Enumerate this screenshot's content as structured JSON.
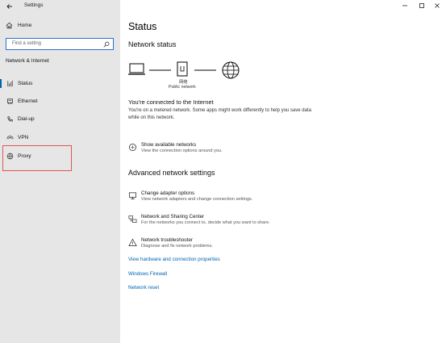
{
  "window": {
    "title": "Settings"
  },
  "sidebar": {
    "home_label": "Home",
    "search_placeholder": "Find a setting",
    "section_heading": "Network & Internet",
    "items": [
      {
        "label": "Status",
        "icon": "home-network-icon",
        "selected": true
      },
      {
        "label": "Ethernet",
        "icon": "ethernet-icon",
        "selected": false
      },
      {
        "label": "Dial-up",
        "icon": "dial-up-icon",
        "selected": false
      },
      {
        "label": "VPN",
        "icon": "vpn-icon",
        "selected": false
      },
      {
        "label": "Proxy",
        "icon": "globe-icon",
        "selected": false
      }
    ]
  },
  "main": {
    "page_title": "Status",
    "network_status_heading": "Network status",
    "diagram": {
      "network_name": "网络",
      "network_type": "Public network"
    },
    "connected_text": "You're connected to the Internet",
    "metered_desc": "You're on a metered network. Some apps might work differently to help you save data while on this network.",
    "show_networks": {
      "title": "Show available networks",
      "subtitle": "View the connection options around you."
    },
    "advanced_heading": "Advanced network settings",
    "actions": [
      {
        "title": "Change adapter options",
        "subtitle": "View network adapters and change connection settings.",
        "icon": "adapter-icon"
      },
      {
        "title": "Network and Sharing Center",
        "subtitle": "For the networks you connect to, decide what you want to share.",
        "icon": "sharing-center-icon"
      },
      {
        "title": "Network troubleshooter",
        "subtitle": "Diagnose and fix network problems.",
        "icon": "warning-icon"
      }
    ],
    "links": [
      "View hardware and connection properties",
      "Windows Firewall",
      "Network reset"
    ]
  },
  "colors": {
    "accent": "#0063b1",
    "sidebar_bg": "#e6e6e6",
    "highlight_border": "#e05555"
  }
}
